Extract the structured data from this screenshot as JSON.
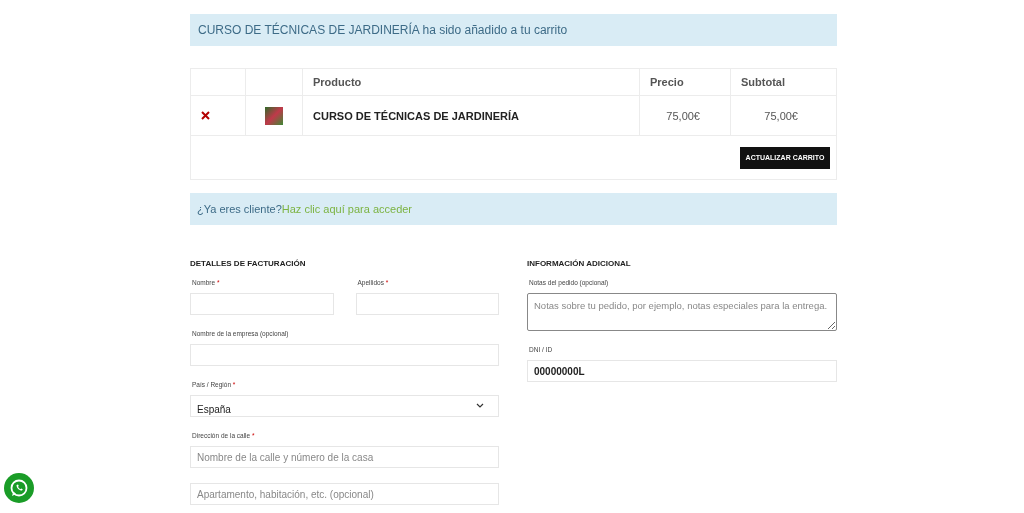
{
  "notice": {
    "product": "CURSO DE TÉCNICAS DE JARDINERÍA",
    "text": "ha sido añadido a tu carrito"
  },
  "cart": {
    "columns": [
      "Producto",
      "Precio",
      "Subtotal"
    ],
    "rows": [
      {
        "name": "CURSO DE TÉCNICAS DE JARDINERÍA",
        "price": "75,00€",
        "subtotal": "75,00€"
      }
    ],
    "update_button": "ACTUALIZAR CARRITO"
  },
  "login_notice": {
    "text": "¿Ya eres cliente?",
    "link": "Haz clic aquí para acceder"
  },
  "billing": {
    "title": "DETALLES DE FACTURACIÓN",
    "rows": [
      [
        {
          "label": "Nombre",
          "required_mark": "*",
          "kind": "text"
        },
        {
          "label": "Apellidos",
          "required_mark": "*",
          "kind": "text"
        }
      ],
      [
        {
          "label": "Nombre de la empresa (opcional)",
          "kind": "text"
        }
      ],
      [
        {
          "label": "País / Región",
          "required_mark": "*",
          "kind": "select",
          "value": "España"
        }
      ],
      [
        {
          "label": "Dirección de la calle",
          "required_mark": "*",
          "kind": "text",
          "placeholder": "Nombre de la calle y número de la casa"
        }
      ],
      [
        {
          "kind": "text",
          "placeholder": "Apartamento, habitación, etc. (opcional)"
        }
      ]
    ]
  },
  "additional": {
    "title": "INFORMACIÓN ADICIONAL",
    "fields": [
      {
        "label": "Notas del pedido (opcional)",
        "kind": "textarea",
        "placeholder": "Notas sobre tu pedido, por ejemplo, notas especiales para la entrega."
      },
      {
        "label": "DNI / ID",
        "kind": "text",
        "value": "00000000L"
      }
    ]
  }
}
